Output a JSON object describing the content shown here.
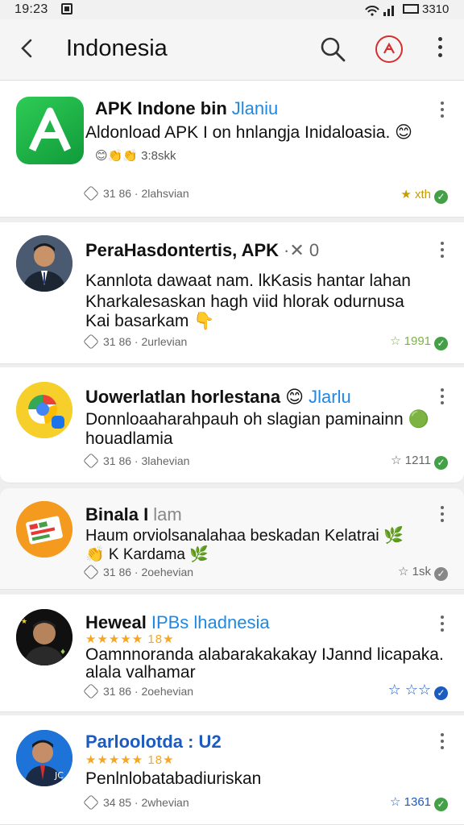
{
  "status_bar": {
    "time": "19:23",
    "battery": "3310"
  },
  "app_bar": {
    "title": "Indonesia"
  },
  "colors": {
    "accent_blue": "#1e88e5",
    "green": "#43a047",
    "star": "#f5a623"
  },
  "items": [
    {
      "name": "APK Indone bin",
      "tag": "Jlaniu",
      "desc_lines": [
        "Aldonload APK I on hnlangja Inidaloasia. 😊"
      ],
      "sub": "😊👏👏 3:8skk",
      "meta": "31  86 · 2lahsvian",
      "count": "★ xth",
      "icon": "android-app-icon"
    },
    {
      "name": "PeraHasdontertis, APK",
      "tag": "·✕ 0",
      "desc_lines": [
        "Kannlota dawaat nam. lkKasis hantar lahan",
        "Kharkalesaskan hagh viid hlorak odurnusa",
        "Kai basarkam 👇"
      ],
      "meta": "31  86 · 2urlevian",
      "count": "☆ 1991",
      "icon": "profile-photo"
    },
    {
      "name": "Uowerlatlan horlestana 😊",
      "tag": "Jlarlu",
      "desc_lines": [
        "Donnloaaharahpauh oh slagian paminainn 🟢",
        "houadlamia"
      ],
      "meta": "31  86 · 3lahevian",
      "count": "☆ 1211",
      "icon": "chrome-logo"
    },
    {
      "name": "Binala I",
      "tag": "lam",
      "desc_lines": [
        "Haum orviolsanalahaa beskadan Kelatrai 🌿",
        "👏 K Kardama 🌿"
      ],
      "meta": "31  86 · 2oehevian",
      "count": "☆ 1sk",
      "icon": "orange-app-icon"
    },
    {
      "name": "Heweal",
      "tag": "IPBs lhadnesia",
      "stars": "★★★★★ 18★",
      "desc_lines": [
        "Oamnnoranda alabarakakakay IJannd licapaka.",
        "alala valhamar"
      ],
      "meta": "31  86 · 2oehevian",
      "count": "☆ ☆☆",
      "icon": "profile-photo-dark"
    },
    {
      "name": "Parloolotda : U2",
      "tag": "",
      "stars": "★★★★★ 18★",
      "desc_lines": [
        "Penlnlobatabadiuriskan"
      ],
      "meta": "34  85 · 2whevian",
      "count": "☆ 1361",
      "icon": "profile-photo-blue"
    }
  ]
}
